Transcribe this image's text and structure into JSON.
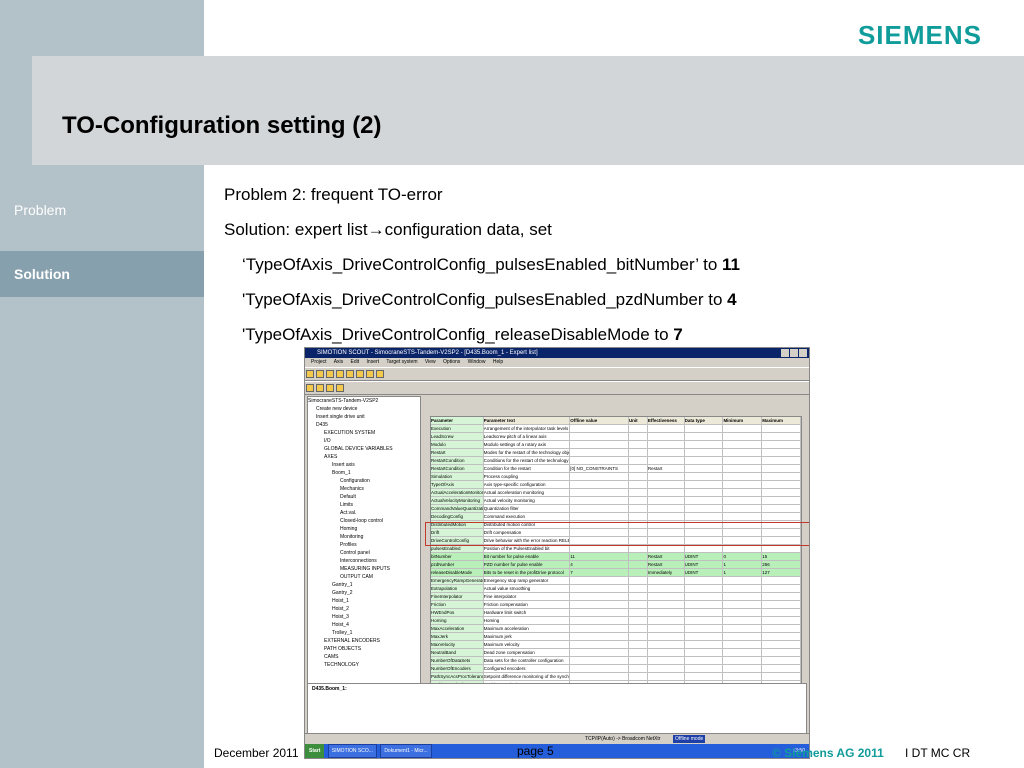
{
  "brand": {
    "logo_text": "SIEMENS"
  },
  "slide": {
    "title": "TO-Configuration setting (2)"
  },
  "sidebar": {
    "items": [
      {
        "label": "Problem"
      },
      {
        "label": "Solution"
      }
    ]
  },
  "content": {
    "lines": [
      "Problem 2: frequent TO-error",
      "Solution: expert list→configuration data, set",
      "‘TypeOfAxis_DriveControlConfig_pulsesEnabled_bitNumber’ to ",
      "'TypeOfAxis_DriveControlConfig_pulsesEnabled_pzdNumber  to ",
      "'TypeOfAxis_DriveControlConfig_releaseDisableMode to "
    ],
    "values": [
      "11",
      "4",
      "7"
    ]
  },
  "footer": {
    "date": "December 2011",
    "page": "page 5",
    "copyright": "© Siemens AG 2011",
    "dept": "I  DT MC CR"
  },
  "screenshot": {
    "window_title": "SIMOTION SCOUT - SimocraneSTS-Tandem-V2SP2 - [D435.Boom_1 - Expert list]",
    "menu": [
      "Project",
      "Axis",
      "Edit",
      "Insert",
      "Target system",
      "View",
      "Options",
      "Window",
      "Help"
    ],
    "tree": [
      "SimocraneSTS-Tandem-V2SP2",
      "Create new device",
      "Insert single drive unit",
      "D435",
      "EXECUTION SYSTEM",
      "I/O",
      "GLOBAL DEVICE VARIABLES",
      "AXES",
      "Insert axis",
      "Boom_1",
      "Configuration",
      "Mechanics",
      "Default",
      "Limits",
      "Act.val.",
      "Closed-loop control",
      "Homing",
      "Monitoring",
      "Profiles",
      "Control panel",
      "Interconnections",
      "MEASURING INPUTS",
      "OUTPUT CAM",
      "Gantry_1",
      "Gantry_2",
      "Hoist_1",
      "Hoist_2",
      "Hoist_3",
      "Hoist_4",
      "Trolley_1",
      "EXTERNAL ENCODERS",
      "PATH OBJECTS",
      "CAMS",
      "TECHNOLOGY"
    ],
    "grid_headers": [
      "Parameter",
      "Parameter text",
      "Offline value",
      "Unit",
      "Effectiveness",
      "Data type",
      "Minimum",
      "Maximum"
    ],
    "grid_rows": [
      [
        "Execution",
        "Arrangement of the interpolator task levels",
        "",
        "",
        "",
        "",
        "",
        ""
      ],
      [
        "LeadScrew",
        "Leadscrew pitch of a linear axis",
        "",
        "",
        "",
        "",
        "",
        ""
      ],
      [
        "Modulo",
        "Modulo settings of a rotary axis",
        "",
        "",
        "",
        "",
        "",
        ""
      ],
      [
        "Restart",
        "Modes for the restart of the technology object",
        "",
        "",
        "",
        "",
        "",
        ""
      ],
      [
        "RestartCondition",
        "Conditions for the restart of the technology",
        "",
        "",
        "",
        "",
        "",
        ""
      ],
      [
        "RestartCondition",
        "Condition for the restart",
        "[0] NO_CONSTRAINTS",
        "",
        "Restart",
        "",
        "",
        ""
      ],
      [
        "Simulation",
        "Process coupling",
        "",
        "",
        "",
        "",
        "",
        ""
      ],
      [
        "TypeOfAxis",
        "Axis type-specific configuration",
        "",
        "",
        "",
        "",
        "",
        ""
      ],
      [
        "ActualAccelerationMonitor",
        "Actual acceleration monitoring",
        "",
        "",
        "",
        "",
        "",
        ""
      ],
      [
        "ActualVelocityMonitoring",
        "Actual velocity monitoring",
        "",
        "",
        "",
        "",
        "",
        ""
      ],
      [
        "CommandValueQuantization",
        "Quantization filter",
        "",
        "",
        "",
        "",
        "",
        ""
      ],
      [
        "DecodingConfig",
        "Command execution",
        "",
        "",
        "",
        "",
        "",
        ""
      ],
      [
        "DistributedMotion",
        "Distributed motion control",
        "",
        "",
        "",
        "",
        "",
        ""
      ],
      [
        "Drift",
        "Drift compensation",
        "",
        "",
        "",
        "",
        "",
        ""
      ],
      [
        "DriveControlConfig",
        "Drive behavior with the error reaction RELEASE",
        "",
        "",
        "",
        "",
        "",
        ""
      ],
      [
        "pulsesEnabled",
        "Position of the PulsesEnabled bit",
        "",
        "",
        "",
        "",
        "",
        ""
      ],
      [
        "bitNumber",
        "Bit number for pulse enable",
        "11",
        "",
        "Restart",
        "UDINT",
        "0",
        "15"
      ],
      [
        "pzdNumber",
        "PZD number for pulse enable",
        "4",
        "",
        "Restart",
        "UDINT",
        "1",
        "256"
      ],
      [
        "releaseDisableMode",
        "Bits to be reset in the profiDrive protocol",
        "7",
        "",
        "Immediately",
        "UDINT",
        "1",
        "127"
      ],
      [
        "EmergencyRampGenerator",
        "Emergency stop ramp generator",
        "",
        "",
        "",
        "",
        "",
        ""
      ],
      [
        "Extrapolation",
        "Actual value smoothing",
        "",
        "",
        "",
        "",
        "",
        ""
      ],
      [
        "FineInterpolator",
        "Fine interpolator",
        "",
        "",
        "",
        "",
        "",
        ""
      ],
      [
        "Friction",
        "Friction compensation",
        "",
        "",
        "",
        "",
        "",
        ""
      ],
      [
        "HWEndPos",
        "Hardware limit switch",
        "",
        "",
        "",
        "",
        "",
        ""
      ],
      [
        "Homing",
        "Homing",
        "",
        "",
        "",
        "",
        "",
        ""
      ],
      [
        "MaxAcceleration",
        "Maximum acceleration",
        "",
        "",
        "",
        "",
        "",
        ""
      ],
      [
        "MaxJerk",
        "Maximum jerk",
        "",
        "",
        "",
        "",
        "",
        ""
      ],
      [
        "MaxVelocity",
        "Maximum velocity",
        "",
        "",
        "",
        "",
        "",
        ""
      ],
      [
        "NeutralBand",
        "Dead zone compensation",
        "",
        "",
        "",
        "",
        "",
        ""
      ],
      [
        "NumberOfDataSets",
        "Data sets for the controller configuration",
        "",
        "",
        "",
        "",
        "",
        ""
      ],
      [
        "NumberOfEncoders",
        "Configured encoders",
        "",
        "",
        "",
        "",
        "",
        ""
      ],
      [
        "PathSyncAcsProcTolerance",
        "Setpoint difference monitoring of the synchronous axis",
        "",
        "",
        "",
        "",
        "",
        ""
      ],
      [
        "PositionMonitoring",
        "Position monitoring",
        "",
        "",
        "",
        "",
        "",
        ""
      ],
      [
        "ServoMonitoring",
        "Activate control loop monitoring with active",
        "",
        "",
        "",
        "",
        "",
        ""
      ],
      [
        "SetPointDriverInfo",
        "Drive interface",
        "",
        "",
        "",
        "",
        "",
        ""
      ],
      [
        "SetpointFilter",
        "Manipulated variable filter",
        "",
        "",
        "",
        "",
        "",
        ""
      ],
      [
        "SmoothingFilter",
        "Actual value smoothing",
        "",
        "",
        "",
        "",
        "",
        ""
      ]
    ],
    "status_text": "TCP/IP(Auto) -> Broadcom NetXtr",
    "offline_mode": "Offline mode",
    "task_items": [
      "SIMOTION SCO...",
      "Dokument1 - Micr..."
    ],
    "clock": "13:50",
    "start_label": "Start",
    "bottom_title": "D435.Boom_1:"
  }
}
